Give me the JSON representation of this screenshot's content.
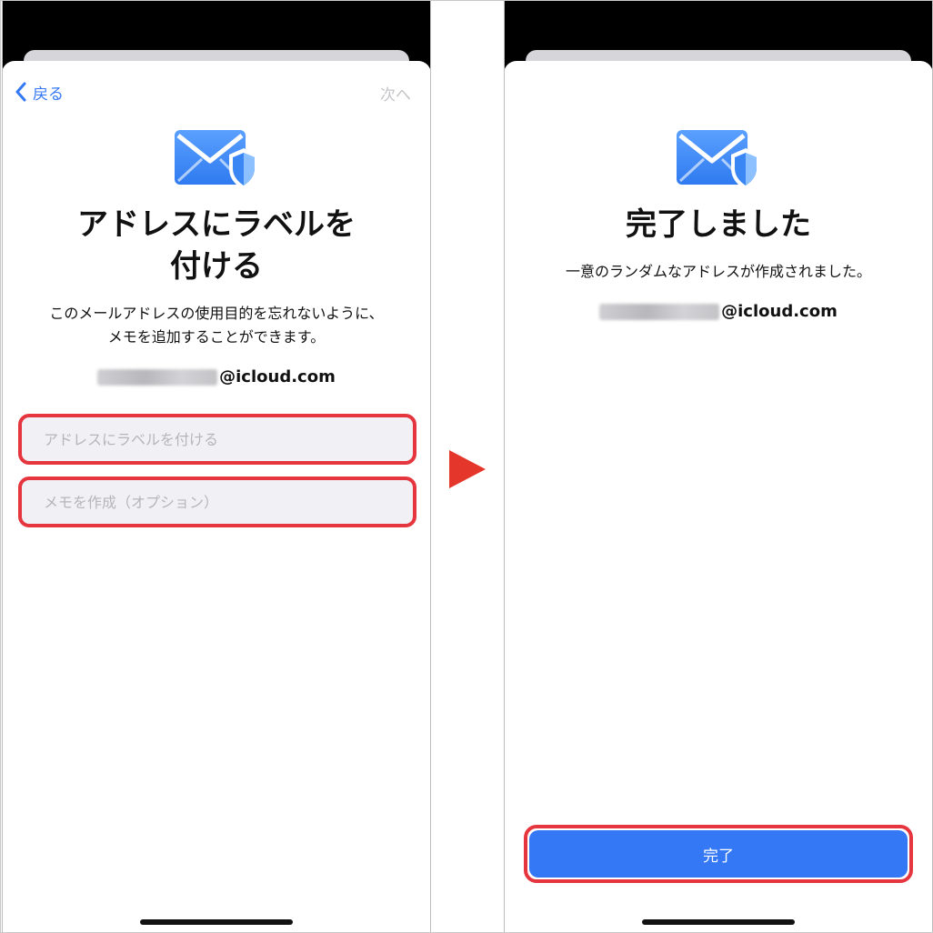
{
  "left_screen": {
    "nav": {
      "back_label": "戻る",
      "next_label": "次へ"
    },
    "title_line1": "アドレスにラベルを",
    "title_line2": "付ける",
    "description_line1": "このメールアドレスの使用目的を忘れないように、",
    "description_line2": "メモを追加することができます。",
    "email_domain": "@icloud.com",
    "label_field": {
      "placeholder": "アドレスにラベルを付ける",
      "value": ""
    },
    "memo_field": {
      "placeholder": "メモを作成（オプション）",
      "value": ""
    }
  },
  "right_screen": {
    "title": "完了しました",
    "description": "一意のランダムなアドレスが作成されました。",
    "email_domain": "@icloud.com",
    "done_button_label": "完了"
  },
  "icons": {
    "mail": "mail-shield-icon",
    "back": "chevron-left-icon",
    "transition": "play-arrow-icon"
  },
  "colors": {
    "accent": "#3478f6",
    "highlight": "#e5363f",
    "arrow": "#e5362b",
    "field_bg": "#f1f1f5"
  }
}
